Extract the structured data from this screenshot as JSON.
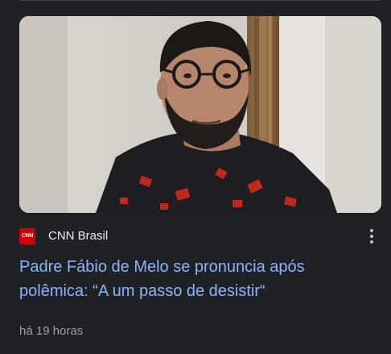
{
  "card": {
    "source": {
      "logo_text": "CNN",
      "name": "CNN Brasil",
      "logo_color": "#cc0000"
    },
    "headline": "Padre Fábio de Melo se pronuncia após polêmica: “A um passo de desistir“",
    "timestamp": "há 19 horas",
    "more_icon": "more-vert-icon",
    "colors": {
      "background": "#202124",
      "headline": "#8ab4f8",
      "source_text": "#e8eaed",
      "meta_text": "#9aa0a6"
    }
  }
}
